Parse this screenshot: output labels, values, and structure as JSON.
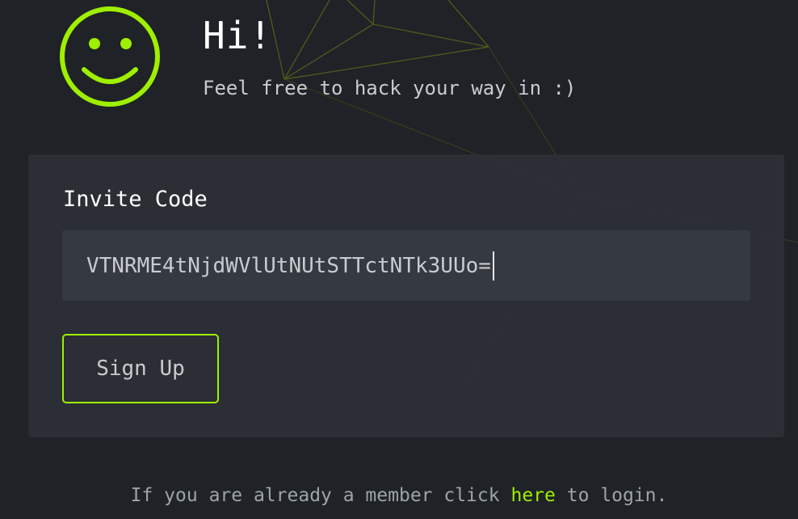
{
  "header": {
    "greeting": "Hi!",
    "subtext": "Feel free to hack your way in :)",
    "logo_icon": "smiley-face-icon"
  },
  "form": {
    "label": "Invite Code",
    "invite_code_value": "VTNRME4tNjdWVlUtNUtSTTctNTk3UUo=",
    "submit_label": "Sign Up"
  },
  "footer": {
    "prefix": "If you are already a member click",
    "link_text": "here",
    "suffix": "to login."
  },
  "colors": {
    "accent": "#9fef00",
    "background": "#1f2227",
    "panel": "#2b2f36",
    "input": "#353a42"
  }
}
